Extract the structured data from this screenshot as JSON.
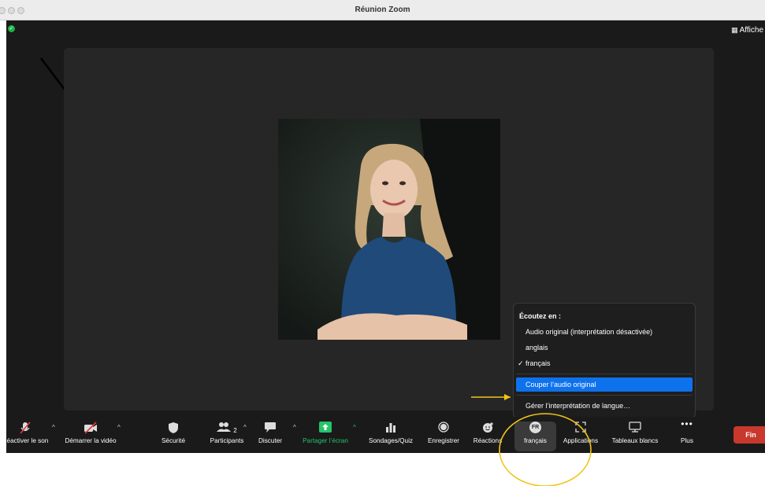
{
  "window": {
    "title": "Réunion Zoom"
  },
  "top_right": {
    "view_label": "Affiche"
  },
  "language_menu": {
    "header": "Écoutez en :",
    "options": [
      {
        "label": "Audio original (interprétation désactivée)",
        "checked": false
      },
      {
        "label": "anglais",
        "checked": false
      },
      {
        "label": "français",
        "checked": true
      }
    ],
    "check_mark": "✓",
    "mute_original": "Couper l’audio original",
    "manage": "Gérer l’interprétation de langue…"
  },
  "toolbar": {
    "unmute": "Réactiver le son",
    "start_video": "Démarrer la vidéo",
    "security": "Sécurité",
    "participants": "Participants",
    "participants_count": "2",
    "chat": "Discuter",
    "share": "Partager l’écran",
    "polls": "Sondages/Quiz",
    "record": "Enregistrer",
    "reactions": "Réactions",
    "language": "français",
    "language_code": "FR",
    "apps": "Applications",
    "whiteboards": "Tableaux blancs",
    "more": "Plus",
    "end": "Fin"
  },
  "colors": {
    "accent_blue": "#0e72ed",
    "share_green": "#25c36a",
    "end_red": "#c8382c",
    "annotation_yellow": "#f2c418"
  }
}
